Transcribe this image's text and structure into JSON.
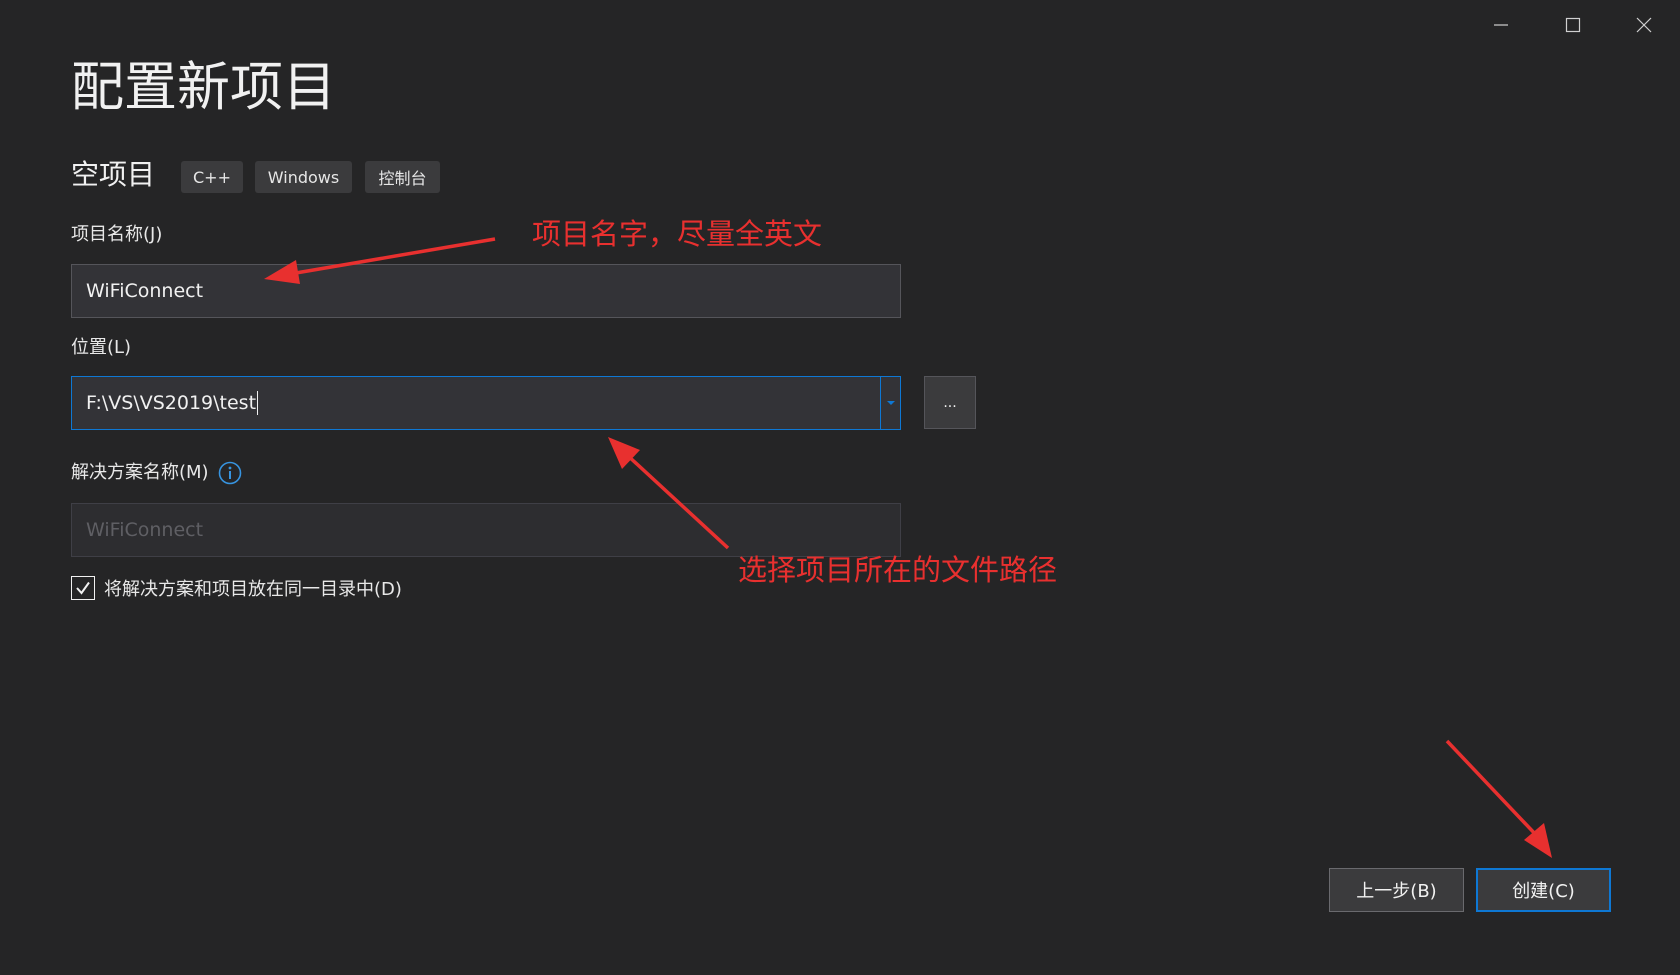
{
  "window": {
    "minimize_icon": "minimize-icon",
    "maximize_icon": "maximize-icon",
    "close_icon": "close-icon"
  },
  "page": {
    "title": "配置新项目",
    "template_name": "空项目",
    "tags": [
      "C++",
      "Windows",
      "控制台"
    ]
  },
  "form": {
    "project_name": {
      "label": "项目名称(J)",
      "value": "WiFiConnect"
    },
    "location": {
      "label": "位置(L)",
      "value": "F:\\VS\\VS2019\\test",
      "browse_label": "..."
    },
    "solution_name": {
      "label": "解决方案名称(M)",
      "placeholder": "WiFiConnect"
    },
    "same_directory": {
      "label": "将解决方案和项目放在同一目录中(D)",
      "checked": true
    }
  },
  "buttons": {
    "back": "上一步(B)",
    "create": "创建(C)"
  },
  "annotations": {
    "project_name_note": "项目名字，尽量全英文",
    "location_note": "选择项目所在的文件路径"
  },
  "colors": {
    "background": "#252526",
    "accent": "#0e78d4",
    "annotation": "#e8302f"
  }
}
